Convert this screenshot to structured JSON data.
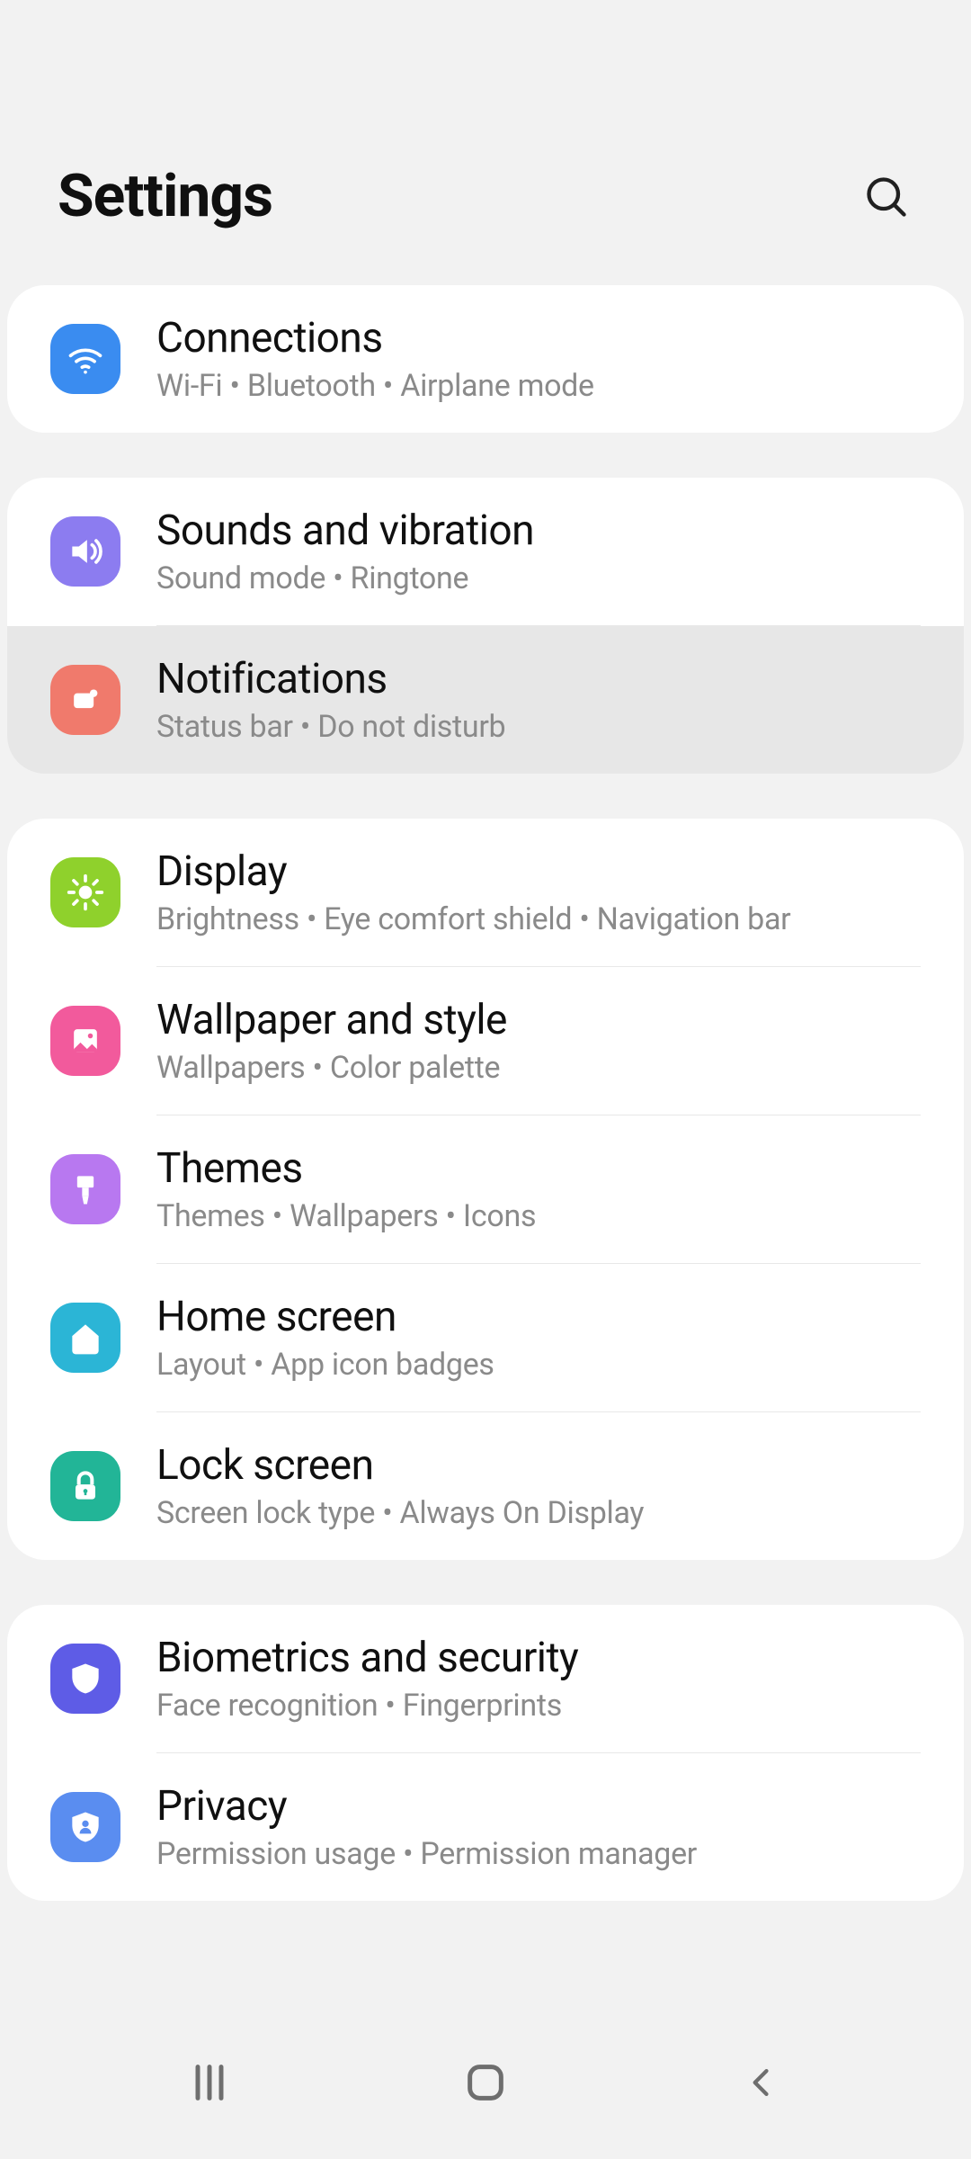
{
  "header": {
    "title": "Settings"
  },
  "groups": [
    {
      "items": [
        {
          "id": "connections",
          "title": "Connections",
          "sub": "Wi-Fi  •  Bluetooth  •  Airplane mode",
          "icon": "wifi-icon",
          "color": "#3a8cf0",
          "highlight": false
        }
      ]
    },
    {
      "items": [
        {
          "id": "sounds",
          "title": "Sounds and vibration",
          "sub": "Sound mode  •  Ringtone",
          "icon": "speaker-icon",
          "color": "#8c7cf0",
          "highlight": false
        },
        {
          "id": "notifications",
          "title": "Notifications",
          "sub": "Status bar  •  Do not disturb",
          "icon": "bell-icon",
          "color": "#f07a6c",
          "highlight": true
        }
      ]
    },
    {
      "items": [
        {
          "id": "display",
          "title": "Display",
          "sub": "Brightness  •  Eye comfort shield  •  Navigation bar",
          "icon": "sun-icon",
          "color": "#8fd12c",
          "highlight": false
        },
        {
          "id": "wallpaper",
          "title": "Wallpaper and style",
          "sub": "Wallpapers  •  Color palette",
          "icon": "image-icon",
          "color": "#f25a9c",
          "highlight": false
        },
        {
          "id": "themes",
          "title": "Themes",
          "sub": "Themes  •  Wallpapers  •  Icons",
          "icon": "brush-icon",
          "color": "#b878f0",
          "highlight": false
        },
        {
          "id": "homescreen",
          "title": "Home screen",
          "sub": "Layout  •  App icon badges",
          "icon": "home-icon",
          "color": "#2bb5d6",
          "highlight": false
        },
        {
          "id": "lockscreen",
          "title": "Lock screen",
          "sub": "Screen lock type  •  Always On Display",
          "icon": "lock-icon",
          "color": "#22b597",
          "highlight": false
        }
      ]
    },
    {
      "items": [
        {
          "id": "biometrics",
          "title": "Biometrics and security",
          "sub": "Face recognition  •  Fingerprints",
          "icon": "shield-icon",
          "color": "#5e5ce6",
          "highlight": false
        },
        {
          "id": "privacy",
          "title": "Privacy",
          "sub": "Permission usage  •  Permission manager",
          "icon": "privacy-icon",
          "color": "#5a8df0",
          "highlight": false
        }
      ]
    }
  ]
}
